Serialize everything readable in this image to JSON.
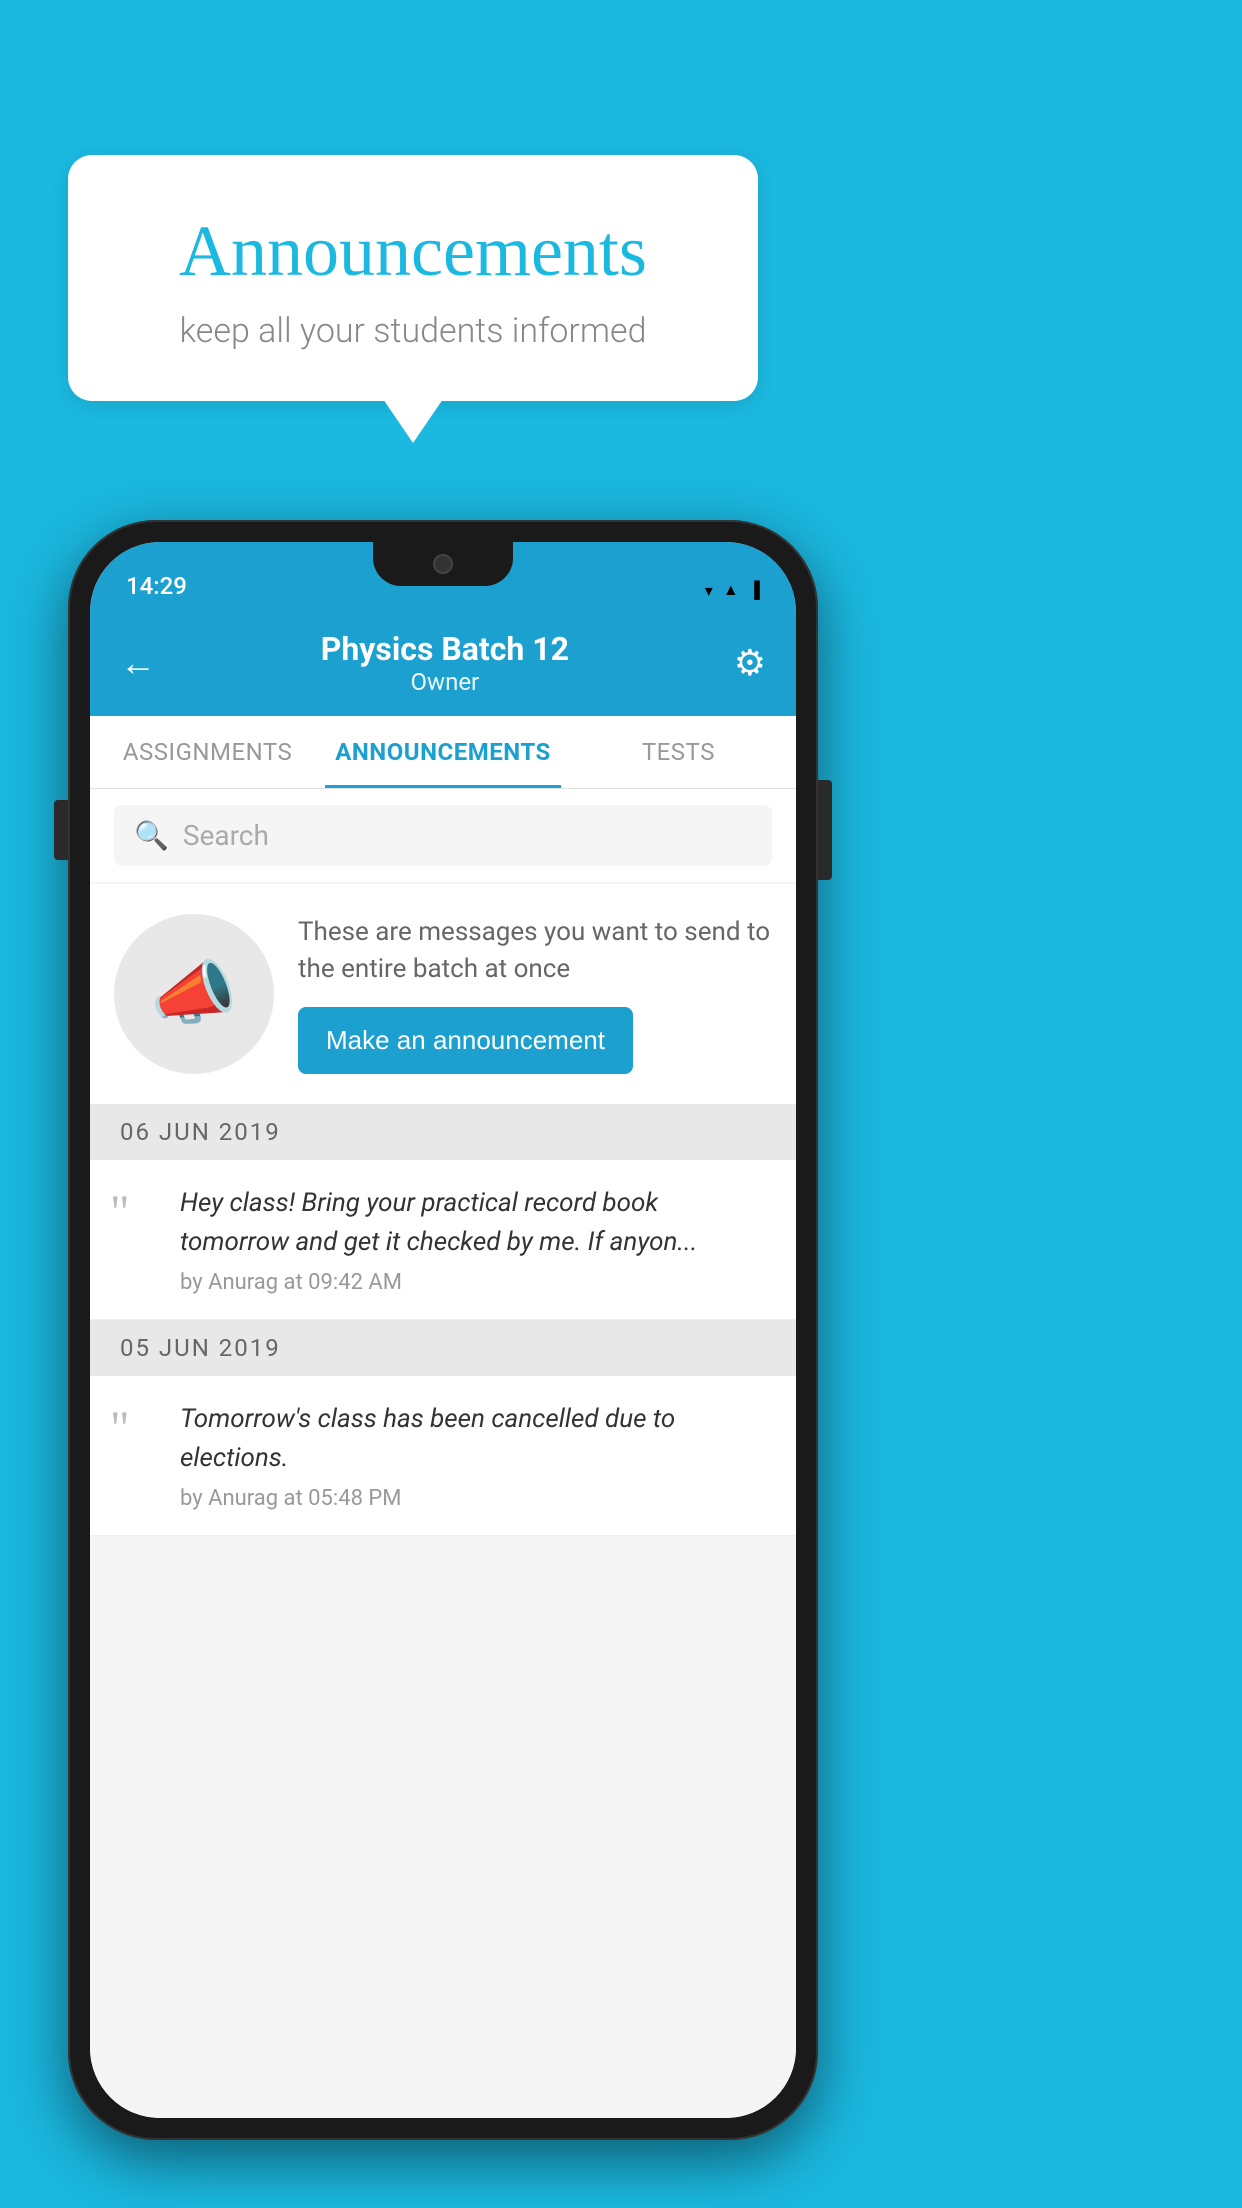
{
  "background": {
    "color": "#1BB8E0"
  },
  "speech_bubble": {
    "title": "Announcements",
    "subtitle": "keep all your students informed"
  },
  "phone": {
    "status_bar": {
      "time": "14:29",
      "wifi": "▼",
      "signal": "▲",
      "battery": "▐"
    },
    "header": {
      "back_label": "←",
      "title": "Physics Batch 12",
      "subtitle": "Owner",
      "settings_label": "⚙"
    },
    "tabs": [
      {
        "label": "ASSIGNMENTS",
        "active": false
      },
      {
        "label": "ANNOUNCEMENTS",
        "active": true
      },
      {
        "label": "TESTS",
        "active": false
      },
      {
        "label": "...",
        "active": false
      }
    ],
    "search": {
      "placeholder": "Search"
    },
    "promo": {
      "description": "These are messages you want to send to the entire batch at once",
      "button_label": "Make an announcement"
    },
    "announcements": [
      {
        "date": "06  JUN  2019",
        "message": "Hey class! Bring your practical record book tomorrow and get it checked by me. If anyon...",
        "meta": "by Anurag at 09:42 AM"
      },
      {
        "date": "05  JUN  2019",
        "message": "Tomorrow's class has been cancelled due to elections.",
        "meta": "by Anurag at 05:48 PM"
      }
    ]
  }
}
